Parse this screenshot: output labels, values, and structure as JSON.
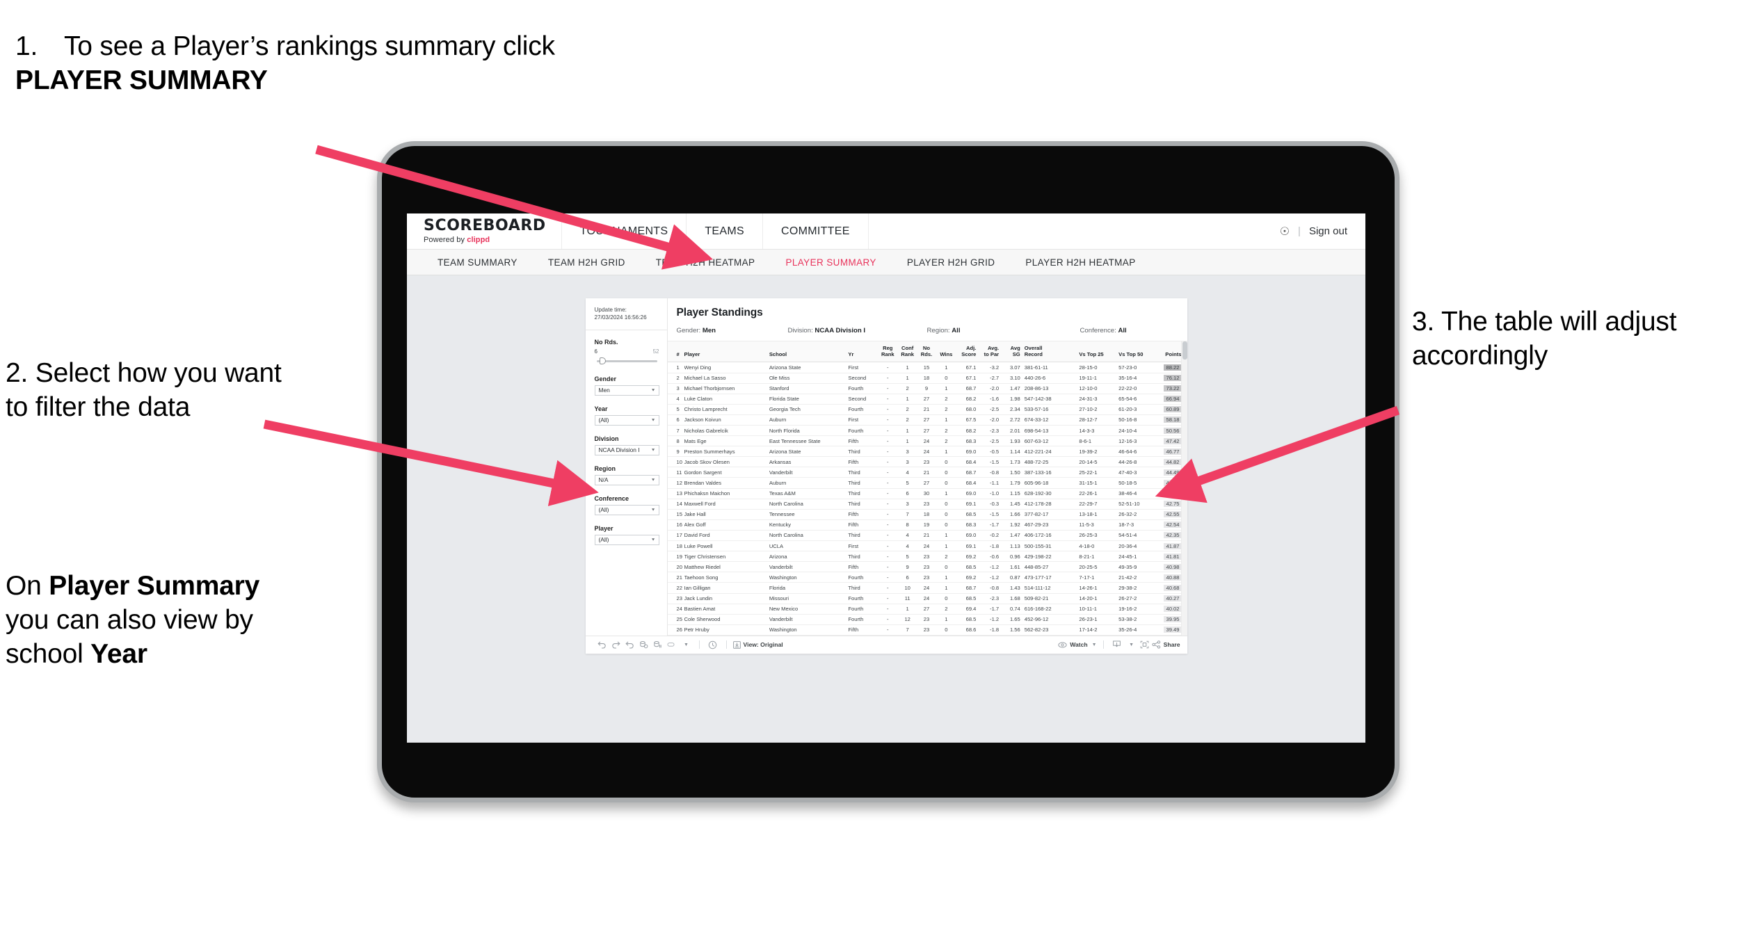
{
  "annotations": {
    "a1_number": "1.",
    "a1_text_before": "To see a Player’s rankings summary click ",
    "a1_bold": "PLAYER SUMMARY",
    "a2": "2. Select how you want to filter the data",
    "a2b_before": "On ",
    "a2b_bold1": "Player Summary",
    "a2b_mid": " you can also view by school ",
    "a2b_bold2": "Year",
    "a3": "3. The table will adjust accordingly",
    "arrow_color": "#ef3e63"
  },
  "app": {
    "brand_title": "SCOREBOARD",
    "brand_sub_prefix": "Powered by ",
    "brand_sub_name": "clippd",
    "top_nav": [
      "TOURNAMENTS",
      "TEAMS",
      "COMMITTEE"
    ],
    "account_icon": "person-icon",
    "separator": "|",
    "sign_out": "Sign out",
    "sub_nav": [
      {
        "label": "TEAM SUMMARY",
        "active": false
      },
      {
        "label": "TEAM H2H GRID",
        "active": false
      },
      {
        "label": "TEAM H2H HEATMAP",
        "active": false
      },
      {
        "label": "PLAYER SUMMARY",
        "active": true
      },
      {
        "label": "PLAYER H2H GRID",
        "active": false
      },
      {
        "label": "PLAYER H2H HEATMAP",
        "active": false
      }
    ],
    "active_accent": "#e8325a"
  },
  "filters": {
    "update_label": "Update time:",
    "update_value": "27/03/2024 16:56:26",
    "slider": {
      "title": "No Rds.",
      "min": "6",
      "max": "52",
      "value_pct": 8
    },
    "selects": [
      {
        "label": "Gender",
        "value": "Men"
      },
      {
        "label": "Year",
        "value": "(All)"
      },
      {
        "label": "Division",
        "value": "NCAA Division I"
      },
      {
        "label": "Region",
        "value": "N/A"
      },
      {
        "label": "Conference",
        "value": "(All)"
      },
      {
        "label": "Player",
        "value": "(All)"
      }
    ]
  },
  "standings": {
    "title": "Player Standings",
    "filter_summary": [
      {
        "label": "Gender: ",
        "value": "Men"
      },
      {
        "label": "Division: ",
        "value": "NCAA Division I"
      },
      {
        "label": "Region: ",
        "value": "All"
      },
      {
        "label": "Conference: ",
        "value": "All"
      }
    ],
    "columns": [
      {
        "key": "rank",
        "head1": "#",
        "head2": ""
      },
      {
        "key": "player",
        "head1": "Player",
        "head2": ""
      },
      {
        "key": "school",
        "head1": "School",
        "head2": ""
      },
      {
        "key": "yr",
        "head1": "Yr",
        "head2": ""
      },
      {
        "key": "reg_rank",
        "head1": "Reg",
        "head2": "Rank"
      },
      {
        "key": "conf_rank",
        "head1": "Conf",
        "head2": "Rank"
      },
      {
        "key": "no_rds",
        "head1": "No",
        "head2": "Rds."
      },
      {
        "key": "wins",
        "head1": "Wins",
        "head2": ""
      },
      {
        "key": "adj_score",
        "head1": "Adj.",
        "head2": "Score"
      },
      {
        "key": "avg_par",
        "head1": "Avg.",
        "head2": "to Par"
      },
      {
        "key": "avg_sg",
        "head1": "Avg",
        "head2": "SG"
      },
      {
        "key": "overall",
        "head1": "Overall",
        "head2": "Record"
      },
      {
        "key": "t25",
        "head1": "Vs Top 25",
        "head2": ""
      },
      {
        "key": "t50",
        "head1": "Vs Top 50",
        "head2": ""
      },
      {
        "key": "points",
        "head1": "Points",
        "head2": ""
      }
    ],
    "rows": [
      {
        "rank": "1",
        "player": "Wenyi Ding",
        "school": "Arizona State",
        "yr": "First",
        "reg_rank": "-",
        "conf_rank": "1",
        "no_rds": "15",
        "wins": "1",
        "adj_score": "67.1",
        "avg_par": "-3.2",
        "avg_sg": "3.07",
        "overall": "381-61-11",
        "t25": "28-15-0",
        "t50": "57-23-0",
        "points": "88.22"
      },
      {
        "rank": "2",
        "player": "Michael La Sasso",
        "school": "Ole Miss",
        "yr": "Second",
        "reg_rank": "-",
        "conf_rank": "1",
        "no_rds": "18",
        "wins": "0",
        "adj_score": "67.1",
        "avg_par": "-2.7",
        "avg_sg": "3.10",
        "overall": "440-26-6",
        "t25": "19-11-1",
        "t50": "35-16-4",
        "points": "76.12"
      },
      {
        "rank": "3",
        "player": "Michael Thorbjornsen",
        "school": "Stanford",
        "yr": "Fourth",
        "reg_rank": "-",
        "conf_rank": "2",
        "no_rds": "9",
        "wins": "1",
        "adj_score": "68.7",
        "avg_par": "-2.0",
        "avg_sg": "1.47",
        "overall": "208-86-13",
        "t25": "12-10-0",
        "t50": "22-22-0",
        "points": "73.22"
      },
      {
        "rank": "4",
        "player": "Luke Claton",
        "school": "Florida State",
        "yr": "Second",
        "reg_rank": "-",
        "conf_rank": "1",
        "no_rds": "27",
        "wins": "2",
        "adj_score": "68.2",
        "avg_par": "-1.6",
        "avg_sg": "1.98",
        "overall": "547-142-38",
        "t25": "24-31-3",
        "t50": "65-54-6",
        "points": "66.94"
      },
      {
        "rank": "5",
        "player": "Christo Lamprecht",
        "school": "Georgia Tech",
        "yr": "Fourth",
        "reg_rank": "-",
        "conf_rank": "2",
        "no_rds": "21",
        "wins": "2",
        "adj_score": "68.0",
        "avg_par": "-2.5",
        "avg_sg": "2.34",
        "overall": "533-57-16",
        "t25": "27-10-2",
        "t50": "61-20-3",
        "points": "60.89"
      },
      {
        "rank": "6",
        "player": "Jackson Koivun",
        "school": "Auburn",
        "yr": "First",
        "reg_rank": "-",
        "conf_rank": "2",
        "no_rds": "27",
        "wins": "1",
        "adj_score": "67.5",
        "avg_par": "-2.0",
        "avg_sg": "2.72",
        "overall": "674-33-12",
        "t25": "28-12-7",
        "t50": "50-16-8",
        "points": "58.18"
      },
      {
        "rank": "7",
        "player": "Nicholas Gabrelcik",
        "school": "North Florida",
        "yr": "Fourth",
        "reg_rank": "-",
        "conf_rank": "1",
        "no_rds": "27",
        "wins": "2",
        "adj_score": "68.2",
        "avg_par": "-2.3",
        "avg_sg": "2.01",
        "overall": "698-54-13",
        "t25": "14-3-3",
        "t50": "24-10-4",
        "points": "50.56"
      },
      {
        "rank": "8",
        "player": "Mats Ege",
        "school": "East Tennessee State",
        "yr": "Fifth",
        "reg_rank": "-",
        "conf_rank": "1",
        "no_rds": "24",
        "wins": "2",
        "adj_score": "68.3",
        "avg_par": "-2.5",
        "avg_sg": "1.93",
        "overall": "607-63-12",
        "t25": "8-6-1",
        "t50": "12-16-3",
        "points": "47.42"
      },
      {
        "rank": "9",
        "player": "Preston Summerhays",
        "school": "Arizona State",
        "yr": "Third",
        "reg_rank": "-",
        "conf_rank": "3",
        "no_rds": "24",
        "wins": "1",
        "adj_score": "69.0",
        "avg_par": "-0.5",
        "avg_sg": "1.14",
        "overall": "412-221-24",
        "t25": "19-39-2",
        "t50": "46-64-6",
        "points": "46.77"
      },
      {
        "rank": "10",
        "player": "Jacob Skov Olesen",
        "school": "Arkansas",
        "yr": "Fifth",
        "reg_rank": "-",
        "conf_rank": "3",
        "no_rds": "23",
        "wins": "0",
        "adj_score": "68.4",
        "avg_par": "-1.5",
        "avg_sg": "1.73",
        "overall": "488-72-25",
        "t25": "20-14-5",
        "t50": "44-26-8",
        "points": "44.82"
      },
      {
        "rank": "11",
        "player": "Gordon Sargent",
        "school": "Vanderbilt",
        "yr": "Third",
        "reg_rank": "-",
        "conf_rank": "4",
        "no_rds": "21",
        "wins": "0",
        "adj_score": "68.7",
        "avg_par": "-0.8",
        "avg_sg": "1.50",
        "overall": "387-133-16",
        "t25": "25-22-1",
        "t50": "47-40-3",
        "points": "44.49"
      },
      {
        "rank": "12",
        "player": "Brendan Valdes",
        "school": "Auburn",
        "yr": "Third",
        "reg_rank": "-",
        "conf_rank": "5",
        "no_rds": "27",
        "wins": "0",
        "adj_score": "68.4",
        "avg_par": "-1.1",
        "avg_sg": "1.79",
        "overall": "605-96-18",
        "t25": "31-15-1",
        "t50": "50-18-5",
        "points": "43.95"
      },
      {
        "rank": "13",
        "player": "Phichaksn Maichon",
        "school": "Texas A&M",
        "yr": "Third",
        "reg_rank": "-",
        "conf_rank": "6",
        "no_rds": "30",
        "wins": "1",
        "adj_score": "69.0",
        "avg_par": "-1.0",
        "avg_sg": "1.15",
        "overall": "628-192-30",
        "t25": "22-26-1",
        "t50": "38-46-4",
        "points": "43.83"
      },
      {
        "rank": "14",
        "player": "Maxwell Ford",
        "school": "North Carolina",
        "yr": "Third",
        "reg_rank": "-",
        "conf_rank": "3",
        "no_rds": "23",
        "wins": "0",
        "adj_score": "69.1",
        "avg_par": "-0.3",
        "avg_sg": "1.45",
        "overall": "412-178-28",
        "t25": "22-29-7",
        "t50": "52-51-10",
        "points": "42.75"
      },
      {
        "rank": "15",
        "player": "Jake Hall",
        "school": "Tennessee",
        "yr": "Fifth",
        "reg_rank": "-",
        "conf_rank": "7",
        "no_rds": "18",
        "wins": "0",
        "adj_score": "68.5",
        "avg_par": "-1.5",
        "avg_sg": "1.66",
        "overall": "377-82-17",
        "t25": "13-18-1",
        "t50": "26-32-2",
        "points": "42.55"
      },
      {
        "rank": "16",
        "player": "Alex Goff",
        "school": "Kentucky",
        "yr": "Fifth",
        "reg_rank": "-",
        "conf_rank": "8",
        "no_rds": "19",
        "wins": "0",
        "adj_score": "68.3",
        "avg_par": "-1.7",
        "avg_sg": "1.92",
        "overall": "467-29-23",
        "t25": "11-5-3",
        "t50": "18-7-3",
        "points": "42.54"
      },
      {
        "rank": "17",
        "player": "David Ford",
        "school": "North Carolina",
        "yr": "Third",
        "reg_rank": "-",
        "conf_rank": "4",
        "no_rds": "21",
        "wins": "1",
        "adj_score": "69.0",
        "avg_par": "-0.2",
        "avg_sg": "1.47",
        "overall": "406-172-16",
        "t25": "26-25-3",
        "t50": "54-51-4",
        "points": "42.35"
      },
      {
        "rank": "18",
        "player": "Luke Powell",
        "school": "UCLA",
        "yr": "First",
        "reg_rank": "-",
        "conf_rank": "4",
        "no_rds": "24",
        "wins": "1",
        "adj_score": "69.1",
        "avg_par": "-1.8",
        "avg_sg": "1.13",
        "overall": "500-155-31",
        "t25": "4-18-0",
        "t50": "20-36-4",
        "points": "41.87"
      },
      {
        "rank": "19",
        "player": "Tiger Christensen",
        "school": "Arizona",
        "yr": "Third",
        "reg_rank": "-",
        "conf_rank": "5",
        "no_rds": "23",
        "wins": "2",
        "adj_score": "69.2",
        "avg_par": "-0.6",
        "avg_sg": "0.96",
        "overall": "429-198-22",
        "t25": "8-21-1",
        "t50": "24-45-1",
        "points": "41.81"
      },
      {
        "rank": "20",
        "player": "Matthew Riedel",
        "school": "Vanderbilt",
        "yr": "Fifth",
        "reg_rank": "-",
        "conf_rank": "9",
        "no_rds": "23",
        "wins": "0",
        "adj_score": "68.5",
        "avg_par": "-1.2",
        "avg_sg": "1.61",
        "overall": "448-85-27",
        "t25": "20-25-5",
        "t50": "49-35-9",
        "points": "40.98"
      },
      {
        "rank": "21",
        "player": "Taehoon Song",
        "school": "Washington",
        "yr": "Fourth",
        "reg_rank": "-",
        "conf_rank": "6",
        "no_rds": "23",
        "wins": "1",
        "adj_score": "69.2",
        "avg_par": "-1.2",
        "avg_sg": "0.87",
        "overall": "473-177-17",
        "t25": "7-17-1",
        "t50": "21-42-2",
        "points": "40.88"
      },
      {
        "rank": "22",
        "player": "Ian Gilligan",
        "school": "Florida",
        "yr": "Third",
        "reg_rank": "-",
        "conf_rank": "10",
        "no_rds": "24",
        "wins": "1",
        "adj_score": "68.7",
        "avg_par": "-0.8",
        "avg_sg": "1.43",
        "overall": "514-111-12",
        "t25": "14-26-1",
        "t50": "29-38-2",
        "points": "40.68"
      },
      {
        "rank": "23",
        "player": "Jack Lundin",
        "school": "Missouri",
        "yr": "Fourth",
        "reg_rank": "-",
        "conf_rank": "11",
        "no_rds": "24",
        "wins": "0",
        "adj_score": "68.5",
        "avg_par": "-2.3",
        "avg_sg": "1.68",
        "overall": "509-82-21",
        "t25": "14-20-1",
        "t50": "26-27-2",
        "points": "40.27"
      },
      {
        "rank": "24",
        "player": "Bastien Amat",
        "school": "New Mexico",
        "yr": "Fourth",
        "reg_rank": "-",
        "conf_rank": "1",
        "no_rds": "27",
        "wins": "2",
        "adj_score": "69.4",
        "avg_par": "-1.7",
        "avg_sg": "0.74",
        "overall": "616-168-22",
        "t25": "10-11-1",
        "t50": "19-16-2",
        "points": "40.02"
      },
      {
        "rank": "25",
        "player": "Cole Sherwood",
        "school": "Vanderbilt",
        "yr": "Fourth",
        "reg_rank": "-",
        "conf_rank": "12",
        "no_rds": "23",
        "wins": "1",
        "adj_score": "68.5",
        "avg_par": "-1.2",
        "avg_sg": "1.65",
        "overall": "452-96-12",
        "t25": "26-23-1",
        "t50": "53-38-2",
        "points": "39.95"
      },
      {
        "rank": "26",
        "player": "Petr Hruby",
        "school": "Washington",
        "yr": "Fifth",
        "reg_rank": "-",
        "conf_rank": "7",
        "no_rds": "23",
        "wins": "0",
        "adj_score": "68.6",
        "avg_par": "-1.8",
        "avg_sg": "1.56",
        "overall": "562-82-23",
        "t25": "17-14-2",
        "t50": "35-26-4",
        "points": "39.49"
      }
    ]
  },
  "toolbar": {
    "undo_icon": "undo-icon",
    "redo_icon": "redo-icon",
    "revert_icon": "revert-icon",
    "refresh_icon": "refresh-data-icon",
    "pause_icon": "pause-updates-icon",
    "device_icon": "device-layout-icon",
    "history_icon": "history-icon",
    "view_icon": "view-icon",
    "view_label": "View: Original",
    "watch_label": "Watch",
    "download_icon": "download-icon",
    "fullscreen_icon": "fullscreen-icon",
    "share_icon": "share-icon",
    "share_label": "Share"
  }
}
